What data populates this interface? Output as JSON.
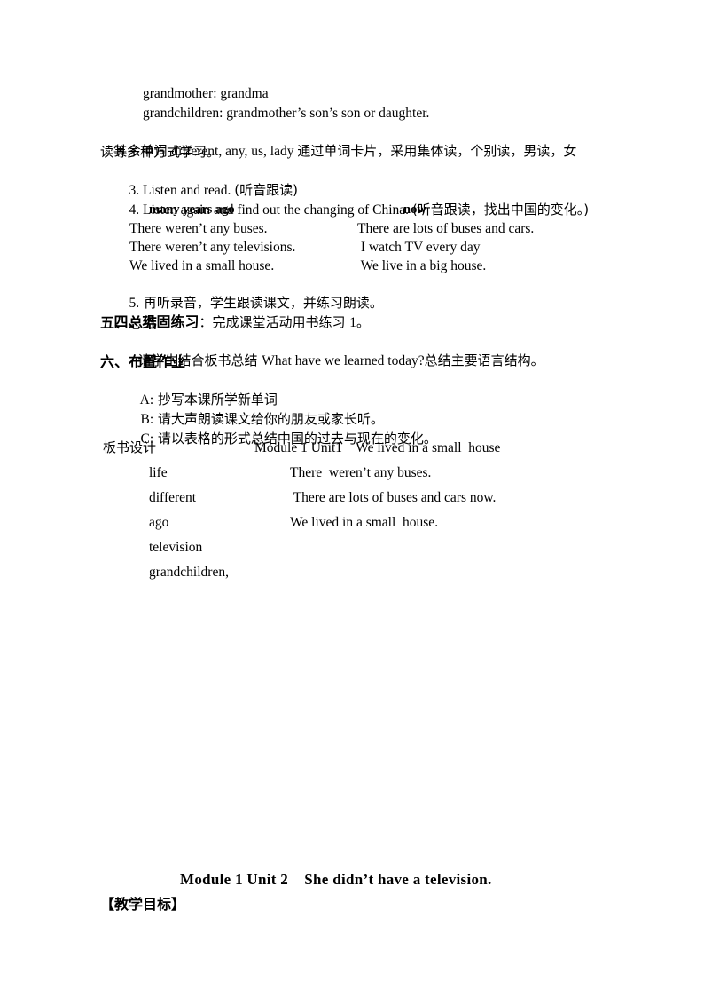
{
  "document": {
    "vocab_notes": [
      "grandmother: grandma",
      "grandchildren: grandmother’s son’s son or daughter."
    ],
    "vocab_paragraph": {
      "part1_cjk": "其余单词 ",
      "part2_lat": "different, any, us, lady ",
      "part3_cjk": "通过单词卡片，采用集体读，个别读，男读，女",
      "line2_cjk": "读等多种方式学习。"
    },
    "steps": [
      {
        "num": "3.",
        "en": " Listen and read. ",
        "cjk": "(听音跟读)"
      },
      {
        "num": "4.",
        "en": " Listen again and find out the changing of China. ",
        "cjk": "(听音跟读，找出中国的变化。)"
      }
    ],
    "compare_table": {
      "headers": [
        "many years ago",
        "now"
      ],
      "rows": [
        [
          "There weren’t any buses.",
          "There are lots of buses and cars."
        ],
        [
          "There weren’t any televisions.",
          " I watch TV every day"
        ],
        [
          "We lived in a small house.",
          " We live in a big house."
        ]
      ]
    },
    "step5": {
      "num": "5.",
      "cjk": " 再听录音，学生跟读课文，并练习朗读。"
    },
    "section_four": {
      "heading": "四、巩固练习",
      "body_cjk": "：完成课堂活动用书练习 ",
      "body_num": "1",
      "body_end": "。"
    },
    "section_five": {
      "heading": "五、总结",
      "body_cjk1": "请学生结合板书总结 ",
      "body_lat": "What have we learned today?",
      "body_cjk2": "总结主要语言结构。"
    },
    "section_six": {
      "heading": "六、布置作业",
      "items": [
        {
          "label": "A:",
          "text": " 抄写本课所学新单词"
        },
        {
          "label": "B:",
          "text": " 请大声朗读课文给你的朋友或家长听。"
        },
        {
          "label": "C:",
          "text": " 请以表格的形式总结中国的过去与现在的变化。"
        }
      ]
    },
    "blackboard": {
      "label": "板书设计",
      "title": "Module 1 Unit1    We lived in a small  house",
      "words": [
        "life",
        "different",
        "ago",
        "television",
        "grandchildren,"
      ],
      "sentences": [
        "There  weren’t any buses.",
        " There are lots of buses and cars now.",
        "We lived in a small  house."
      ]
    },
    "next_unit": {
      "title": "Module 1 Unit 2    She didn’t have a television.",
      "objectives_heading": "【教学目标】"
    }
  }
}
